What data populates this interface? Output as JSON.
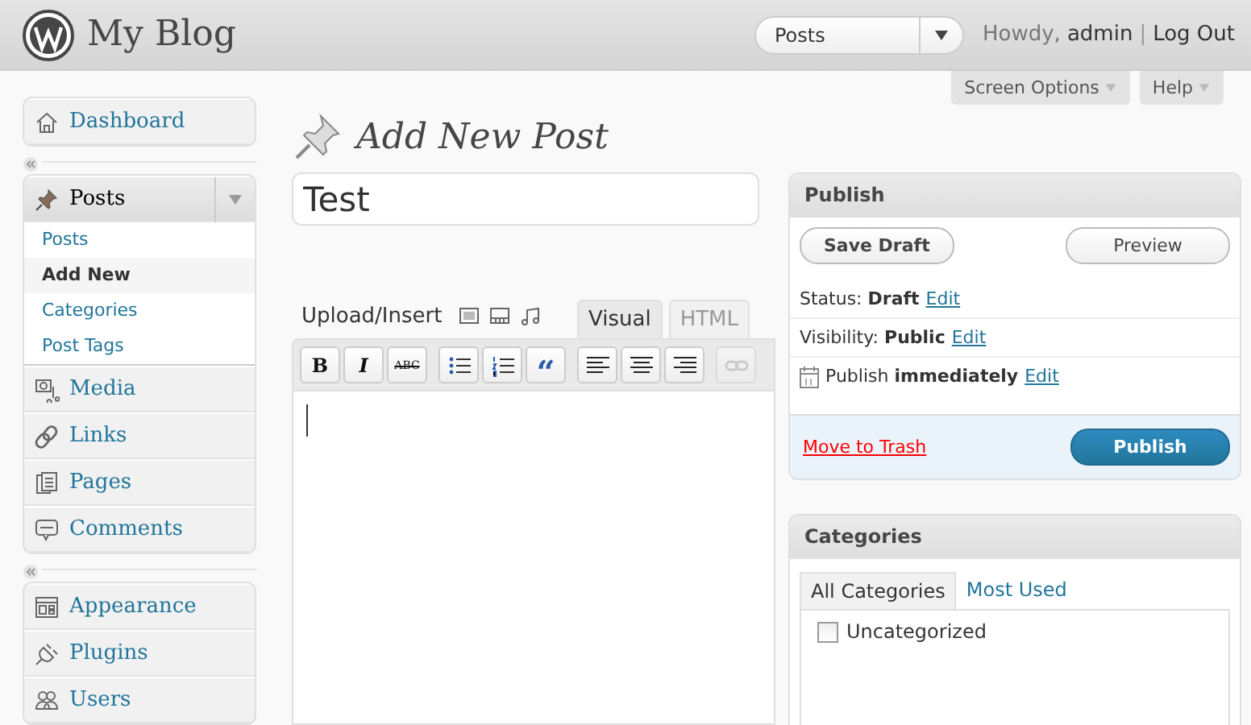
{
  "header": {
    "site_title": "My Blog",
    "quick_menu": {
      "value": "Posts"
    },
    "greeting": "Howdy,",
    "user": "admin",
    "separator": "|",
    "logout": "Log Out"
  },
  "screen_tabs": [
    "Screen Options",
    "Help"
  ],
  "sidebar": {
    "groups": [
      {
        "items": [
          {
            "label": "Dashboard",
            "kind": "house",
            "expanded": false
          }
        ]
      },
      {
        "items": [
          {
            "label": "Posts",
            "kind": "pin",
            "expanded": true,
            "children": [
              {
                "label": "Posts",
                "selected": false
              },
              {
                "label": "Add New",
                "selected": true
              },
              {
                "label": "Categories",
                "selected": false
              },
              {
                "label": "Post Tags",
                "selected": false
              }
            ]
          },
          {
            "label": "Media",
            "kind": "media",
            "expanded": false
          },
          {
            "label": "Links",
            "kind": "link",
            "expanded": false
          },
          {
            "label": "Pages",
            "kind": "pages",
            "expanded": false
          },
          {
            "label": "Comments",
            "kind": "comment",
            "expanded": false
          }
        ]
      },
      {
        "items": [
          {
            "label": "Appearance",
            "kind": "layout",
            "expanded": false
          },
          {
            "label": "Plugins",
            "kind": "plug",
            "expanded": false
          },
          {
            "label": "Users",
            "kind": "users",
            "expanded": false
          }
        ]
      }
    ]
  },
  "page_title": "Add New Post",
  "post_title": {
    "value": "Test"
  },
  "editor": {
    "upload_label": "Upload/Insert",
    "media_buttons": [
      {
        "kind": "image"
      },
      {
        "kind": "video"
      },
      {
        "kind": "audio"
      }
    ],
    "tabs": [
      {
        "label": "Visual",
        "selected": true
      },
      {
        "label": "HTML",
        "selected": false
      }
    ],
    "toolbar": [
      {
        "buttons": [
          {
            "kind": "bold",
            "label": "B",
            "disabled": false
          },
          {
            "kind": "italic",
            "label": "I",
            "disabled": false
          },
          {
            "kind": "strike",
            "label": "ABC",
            "disabled": false
          }
        ]
      },
      {
        "buttons": [
          {
            "kind": "bullets",
            "disabled": false
          },
          {
            "kind": "numbers",
            "disabled": false
          },
          {
            "kind": "quote",
            "label": "“",
            "disabled": false
          }
        ]
      },
      {
        "buttons": [
          {
            "kind": "align-left",
            "disabled": false
          },
          {
            "kind": "align-center",
            "disabled": false
          },
          {
            "kind": "align-right",
            "disabled": false
          }
        ]
      },
      {
        "buttons": [
          {
            "kind": "link",
            "disabled": true
          }
        ]
      }
    ]
  },
  "publish": {
    "title": "Publish",
    "save_draft": "Save Draft",
    "preview": "Preview",
    "rows": [
      {
        "label": "Status:",
        "value": "Draft",
        "link": "Edit",
        "kind": "text"
      },
      {
        "label": "Visibility:",
        "value": "Public",
        "link": "Edit",
        "kind": "text"
      },
      {
        "label": "Publish",
        "value": "immediately",
        "link": "Edit",
        "kind": "calendar"
      }
    ],
    "trash": "Move to Trash",
    "publish_button": "Publish"
  },
  "categories": {
    "title": "Categories",
    "tabs": [
      {
        "label": "All Categories",
        "selected": true
      },
      {
        "label": "Most Used",
        "selected": false
      }
    ],
    "items": [
      {
        "label": "Uncategorized",
        "checked": false
      }
    ]
  }
}
